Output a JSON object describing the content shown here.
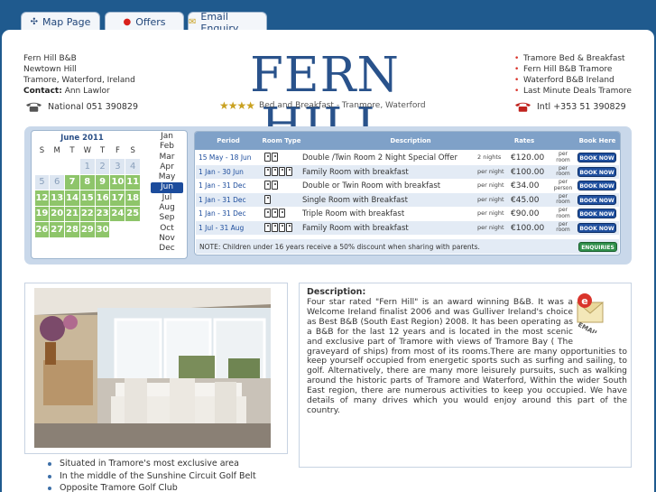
{
  "tabs": [
    {
      "label": "Map Page",
      "icon": "compass-icon"
    },
    {
      "label": "Offers",
      "icon": "red-dot-icon"
    },
    {
      "label": "Email Enquiry",
      "icon": "envelope-icon"
    }
  ],
  "header": {
    "address": [
      "Fern Hill B&B",
      "Newtown Hill",
      "Tramore, Waterford, Ireland"
    ],
    "contact_label": "Contact:",
    "contact_name": "Ann Lawlor",
    "national_phone": "National 051 390829",
    "intl_phone": "Intl +353 51 390829",
    "logo_title": "Fern Hill",
    "rating_stars": "★★★★",
    "logo_subtitle": "Bed and Breakfast - Tranmore, Waterford",
    "links": [
      "Tramore Bed & Breakfast",
      "Fern Hill B&B Tramore",
      "Waterford B&B Ireland",
      "Last Minute Deals Tramore"
    ]
  },
  "calendar": {
    "title": "June 2011",
    "weekday_headers": [
      "S",
      "M",
      "T",
      "W",
      "T",
      "F",
      "S"
    ],
    "days": [
      {
        "d": "",
        "s": "empty"
      },
      {
        "d": "",
        "s": "empty"
      },
      {
        "d": "",
        "s": "empty"
      },
      {
        "d": "1",
        "s": "past"
      },
      {
        "d": "2",
        "s": "past"
      },
      {
        "d": "3",
        "s": "past"
      },
      {
        "d": "4",
        "s": "past"
      },
      {
        "d": "5",
        "s": "past"
      },
      {
        "d": "6",
        "s": "past"
      },
      {
        "d": "7",
        "s": "avail"
      },
      {
        "d": "8",
        "s": "avail"
      },
      {
        "d": "9",
        "s": "avail"
      },
      {
        "d": "10",
        "s": "avail"
      },
      {
        "d": "11",
        "s": "avail"
      },
      {
        "d": "12",
        "s": "avail"
      },
      {
        "d": "13",
        "s": "avail"
      },
      {
        "d": "14",
        "s": "avail"
      },
      {
        "d": "15",
        "s": "avail"
      },
      {
        "d": "16",
        "s": "avail"
      },
      {
        "d": "17",
        "s": "avail"
      },
      {
        "d": "18",
        "s": "avail"
      },
      {
        "d": "19",
        "s": "avail"
      },
      {
        "d": "20",
        "s": "avail"
      },
      {
        "d": "21",
        "s": "avail"
      },
      {
        "d": "22",
        "s": "avail"
      },
      {
        "d": "23",
        "s": "avail"
      },
      {
        "d": "24",
        "s": "avail"
      },
      {
        "d": "25",
        "s": "avail"
      },
      {
        "d": "26",
        "s": "avail"
      },
      {
        "d": "27",
        "s": "avail"
      },
      {
        "d": "28",
        "s": "avail"
      },
      {
        "d": "29",
        "s": "avail"
      },
      {
        "d": "30",
        "s": "avail"
      }
    ],
    "months": [
      "Jan",
      "Feb",
      "Mar",
      "Apr",
      "May",
      "Jun",
      "Jul",
      "Aug",
      "Sep",
      "Oct",
      "Nov",
      "Dec"
    ],
    "selected_month": "Jun",
    "colors": {
      "available": "#8ec56a",
      "past": "#dde6f1",
      "selected": "#1c4c9c"
    }
  },
  "rates": {
    "headers": {
      "period": "Period",
      "room_type": "Room Type",
      "description": "Description",
      "rates": "Rates",
      "book_here": "Book Here"
    },
    "rows": [
      {
        "period": "15 May - 18 Jun",
        "people": 2,
        "description": "Double /Twin Room 2 Night Special Offer",
        "unit": "2 nights",
        "price": "€120.00",
        "per": "per room",
        "book": "BOOK NOW"
      },
      {
        "period": "1 Jan - 30 Jun",
        "people": 4,
        "description": "Family Room with breakfast",
        "unit": "per night",
        "price": "€100.00",
        "per": "per room",
        "book": "BOOK NOW"
      },
      {
        "period": "1 Jan - 31 Dec",
        "people": 2,
        "description": "Double or Twin Room with breakfast",
        "unit": "per night",
        "price": "€34.00",
        "per": "per person",
        "book": "BOOK NOW"
      },
      {
        "period": "1 Jan - 31 Dec",
        "people": 1,
        "description": "Single Room with Breakfast",
        "unit": "per night",
        "price": "€45.00",
        "per": "per room",
        "book": "BOOK NOW"
      },
      {
        "period": "1 Jan - 31 Dec",
        "people": 3,
        "description": "Triple Room with breakfast",
        "unit": "per night",
        "price": "€90.00",
        "per": "per room",
        "book": "BOOK NOW"
      },
      {
        "period": "1 Jul - 31 Aug",
        "people": 4,
        "description": "Family Room with breakfast",
        "unit": "per night",
        "price": "€100.00",
        "per": "per room",
        "book": "BOOK NOW"
      }
    ],
    "note": "NOTE: Children under 16 years receive a 50% discount when sharing with parents.",
    "enquiries_button": "ENQUIRIES"
  },
  "features": [
    "Situated in Tramore's most exclusive area",
    "In the middle of the Sunshine Circuit Golf Belt",
    "Opposite Tramore Golf Club"
  ],
  "description": {
    "label": "Description:",
    "email_badge": "EMAIL ENQUIRIES",
    "text": "Four star rated \"Fern Hill\" is an award winning B&B. It was a Welcome Ireland finalist 2006 and was Gulliver Ireland's choice as Best B&B (South East Region) 2008. It has been operating as a B&B for the last 12 years and is located in the most scenic and exclusive part of Tramore with views of Tramore Bay ( The graveyard of ships) from most of its rooms.There are many opportunities to keep yourself occupied from energetic sports such as surfing and sailing, to golf. Alternatively, there are many more leisurely pursuits, such as walking around the historic parts of Tramore and Waterford, Within the wider South East region, there are numerous activities to keep you occupied. We have details of many drives which you would enjoy around this part of the country."
  }
}
